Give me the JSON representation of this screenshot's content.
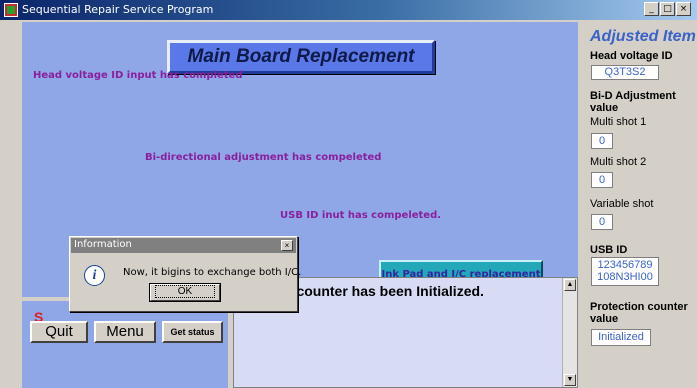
{
  "window": {
    "title": "Sequential Repair Service Program",
    "controls": [
      "_",
      "□",
      "×"
    ]
  },
  "main": {
    "header": "Main Board Replacement",
    "messages": [
      "Head voltage ID input has completed",
      "Bi-directional adjustment has compeleted",
      "USB ID inut has compeleted."
    ],
    "ink_pad_button": "Ink Pad and I/C replacement",
    "log_text": "n counter has been Initialized."
  },
  "bottom_left": {
    "caption": "S",
    "quit_label": "Quit",
    "menu_label": "Menu",
    "get_status_label": "Get status"
  },
  "adjusted_items": {
    "title": "Adjusted Item",
    "head_voltage_label": "Head voltage ID",
    "head_voltage_value": "Q3T3S2",
    "bid_label_line1": "Bi-D Adjustment",
    "bid_label_line2": "value",
    "multi_shot_1_label": "Multi shot 1",
    "multi_shot_1_value": "0",
    "multi_shot_2_label": "Multi shot 2",
    "multi_shot_2_value": "0",
    "variable_shot_label": "Variable shot",
    "variable_shot_value": "0",
    "usb_id_label": "USB ID",
    "usb_id_line1": "123456789",
    "usb_id_line2": "108N3HI00",
    "protection_label_line1": "Protection counter",
    "protection_label_line2": "value",
    "protection_value": "Initialized"
  },
  "dialog": {
    "title": "Information",
    "message": "Now, it bigins to exchange both I/C.",
    "ok_label": "OK",
    "close_glyph": "×",
    "icon_glyph": "i"
  },
  "colors": {
    "main_panel": "#8fa7e6",
    "header_bg": "#5a78e8",
    "message_text": "#8a1f9e",
    "ink_pad_button": "#22a8b8",
    "side_title": "#3a62c8",
    "caption_red": "#e02020"
  }
}
